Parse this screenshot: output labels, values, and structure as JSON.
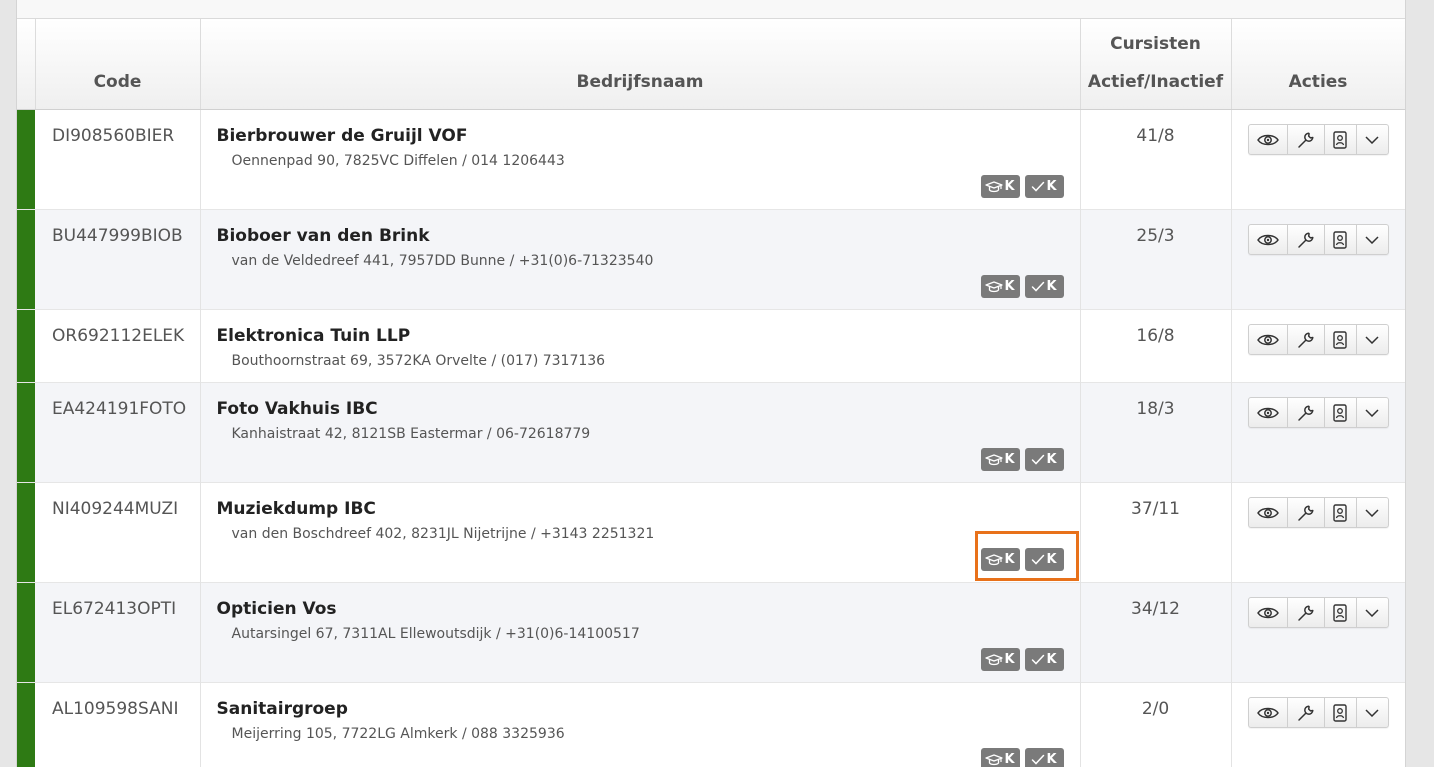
{
  "table": {
    "headers": {
      "code": "Code",
      "bedrijfsnaam": "Bedrijfsnaam",
      "cursisten_line1": "Cursisten",
      "cursisten_line2": "Actief/Inactief",
      "acties": "Acties"
    },
    "badge_letter": "K",
    "rows": [
      {
        "code": "DI908560BIER",
        "name": "Bierbrouwer de Gruijl VOF",
        "address": "Oennenpad 90, 7825VC Diffelen / 014 1206443",
        "count": "41/8",
        "badges": true,
        "highlighted": false
      },
      {
        "code": "BU447999BIOB",
        "name": "Bioboer van den Brink",
        "address": "van de Veldedreef 441, 7957DD Bunne / +31(0)6-71323540",
        "count": "25/3",
        "badges": true,
        "highlighted": false
      },
      {
        "code": "OR692112ELEK",
        "name": "Elektronica Tuin LLP",
        "address": "Bouthoornstraat 69, 3572KA Orvelte / (017) 7317136",
        "count": "16/8",
        "badges": false,
        "highlighted": false
      },
      {
        "code": "EA424191FOTO",
        "name": "Foto Vakhuis IBC",
        "address": "Kanhaistraat 42, 8121SB Eastermar / 06-72618779",
        "count": "18/3",
        "badges": true,
        "highlighted": false
      },
      {
        "code": "NI409244MUZI",
        "name": "Muziekdump IBC",
        "address": "van den Boschdreef 402, 8231JL Nijetrijne / +3143 2251321",
        "count": "37/11",
        "badges": true,
        "highlighted": true
      },
      {
        "code": "EL672413OPTI",
        "name": "Opticien Vos",
        "address": "Autarsingel 67, 7311AL Ellewoutsdijk / +31(0)6-14100517",
        "count": "34/12",
        "badges": true,
        "highlighted": false
      },
      {
        "code": "AL109598SANI",
        "name": "Sanitairgroep",
        "address": "Meijerring 105, 7722LG Almkerk / 088 3325936",
        "count": "2/0",
        "badges": true,
        "highlighted": false
      }
    ]
  },
  "colors": {
    "status_active": "#2e7a14",
    "highlight": "#e8711a",
    "badge_bg": "#7a7a7a"
  },
  "icons": {
    "action_buttons": [
      "eye-icon",
      "wrench-icon",
      "contact-card-icon",
      "chevron-down-icon"
    ],
    "badges": [
      "graduation-cap-icon",
      "checkmark-icon"
    ]
  }
}
